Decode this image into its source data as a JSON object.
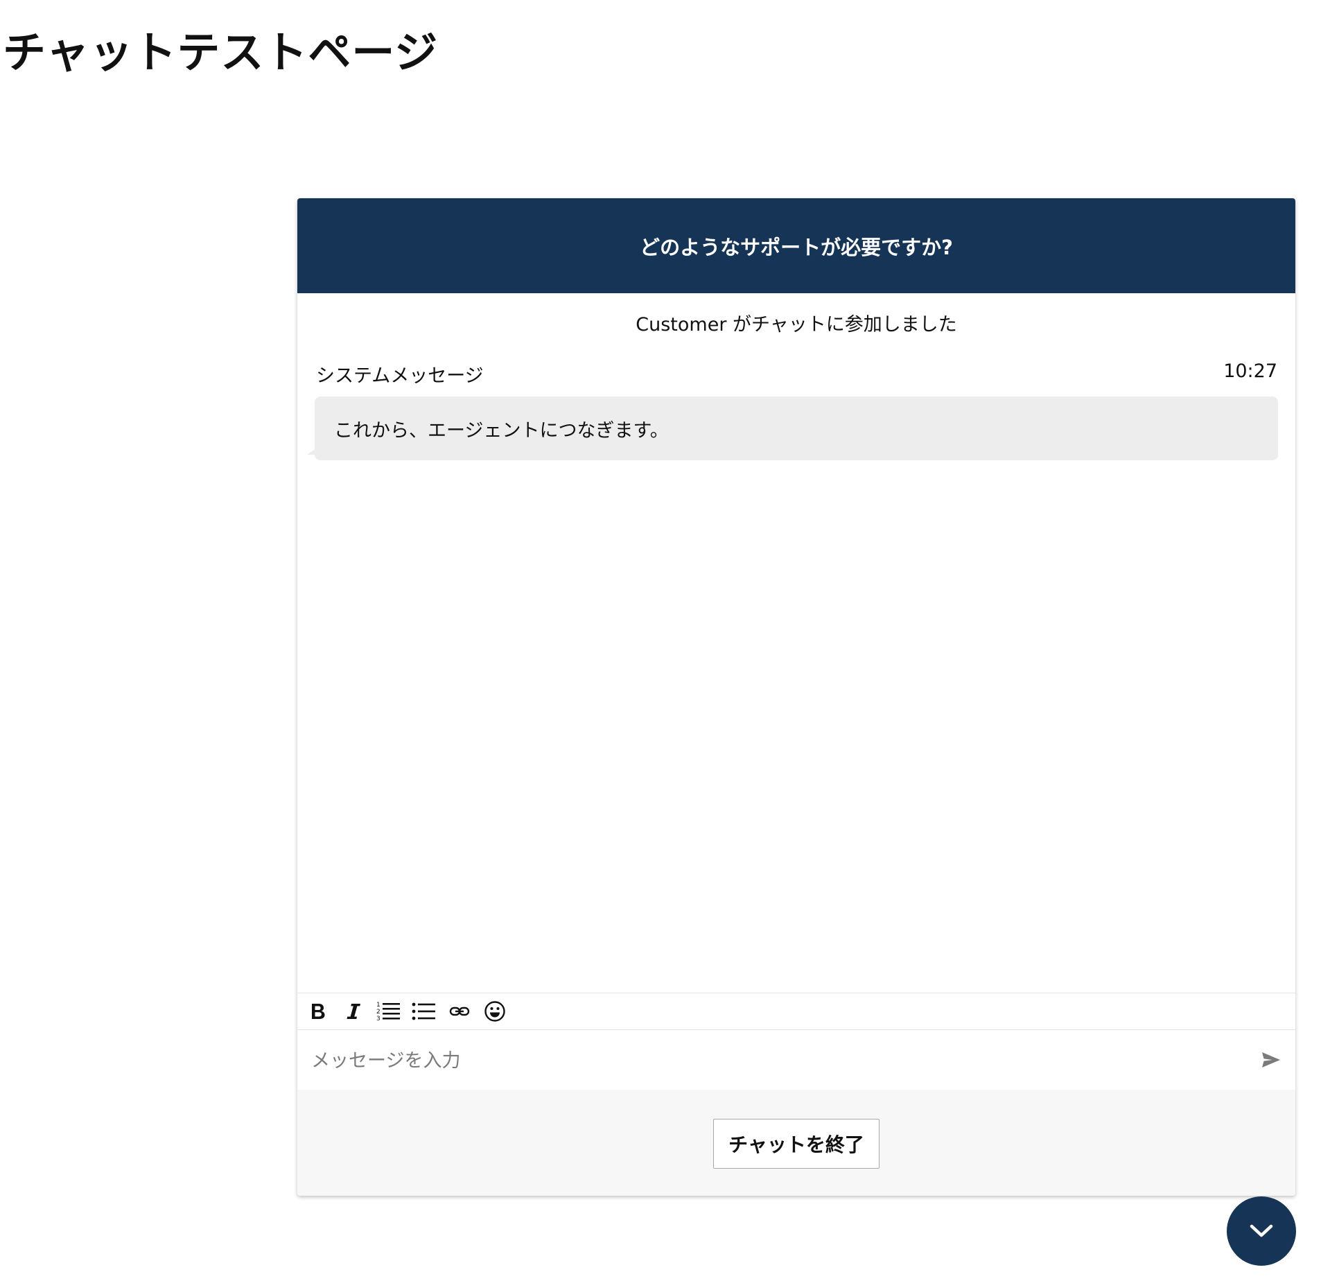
{
  "page": {
    "title": "チャットテストページ"
  },
  "chat": {
    "header_title": "どのようなサポートが必要ですか?",
    "joined_notice": "Customer がチャットに参加しました",
    "messages": [
      {
        "sender": "システムメッセージ",
        "time": "10:27",
        "text": "これから、エージェントにつなぎます。"
      }
    ],
    "toolbar": {
      "icons": [
        "bold-icon",
        "italic-icon",
        "numbered-list-icon",
        "bulleted-list-icon",
        "link-icon",
        "emoji-icon"
      ]
    },
    "composer": {
      "placeholder": "メッセージを入力",
      "value": ""
    },
    "end_chat_label": "チャットを終了"
  },
  "colors": {
    "header_bg": "#163456",
    "bubble_bg": "#ededed",
    "footer_bg": "#f7f7f7",
    "fab_bg": "#163456"
  }
}
